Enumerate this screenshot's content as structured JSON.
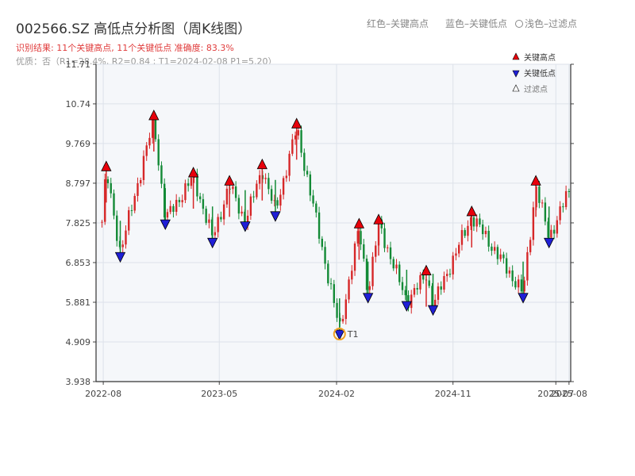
{
  "header": {
    "title": "002566.SZ 高低点分析图（周K线图）",
    "summary": "识别结果: 11个关键高点, 11个关键低点   准确度: 83.3%",
    "quality": "优质：否（R1=28.4%, R2=0.84 ; T1=2024-02-08 P1=5.20）"
  },
  "top_legend": {
    "high": "红色–关键高点",
    "low": "蓝色–关键低点",
    "filtered": "浅色–过滤点"
  },
  "colors": {
    "up": "#d62728",
    "down": "#138a36",
    "high_marker": "#e8000b",
    "low_marker": "#1f1fd6",
    "t1": "#f0a020",
    "plot_bg": "#f5f7fa",
    "grid": "#dde2ea"
  },
  "chart_data": {
    "type": "candlestick",
    "title": "002566.SZ 高低点分析图（周K线图）",
    "ylim": [
      3.938,
      11.71
    ],
    "yticks": [
      "3.938",
      "4.909",
      "5.881",
      "6.853",
      "7.825",
      "8.797",
      "9.769",
      "10.74",
      "11.71"
    ],
    "xlim": [
      "2022-07-15",
      "2025-08-05"
    ],
    "xticks": [
      {
        "label": "2022-08",
        "date": "2022-08-01"
      },
      {
        "label": "2023-05",
        "date": "2023-05-01"
      },
      {
        "label": "2024-02",
        "date": "2024-02-01"
      },
      {
        "label": "2024-11",
        "date": "2024-11-01"
      },
      {
        "label": "2025-07",
        "date": "2025-07-01"
      },
      {
        "label": "2025-08",
        "date": "2025-08-01"
      }
    ],
    "key_highs": [
      {
        "date": "2022-08-08",
        "value": 9.1
      },
      {
        "date": "2022-11-28",
        "value": 10.35
      },
      {
        "date": "2023-03-01",
        "value": 8.95
      },
      {
        "date": "2023-05-25",
        "value": 8.75
      },
      {
        "date": "2023-08-10",
        "value": 9.15
      },
      {
        "date": "2023-10-30",
        "value": 10.15
      },
      {
        "date": "2024-03-25",
        "value": 7.7
      },
      {
        "date": "2024-05-10",
        "value": 7.8
      },
      {
        "date": "2024-08-30",
        "value": 6.55
      },
      {
        "date": "2024-12-15",
        "value": 8.0
      },
      {
        "date": "2025-05-15",
        "value": 8.75
      }
    ],
    "key_lows": [
      {
        "date": "2022-09-10",
        "value": 7.1
      },
      {
        "date": "2022-12-25",
        "value": 7.9
      },
      {
        "date": "2023-04-15",
        "value": 7.45
      },
      {
        "date": "2023-07-01",
        "value": 7.85
      },
      {
        "date": "2023-09-10",
        "value": 8.1
      },
      {
        "date": "2024-02-08",
        "value": 5.2
      },
      {
        "date": "2024-04-15",
        "value": 6.1
      },
      {
        "date": "2024-07-15",
        "value": 5.9
      },
      {
        "date": "2024-09-15",
        "value": 5.8
      },
      {
        "date": "2025-04-15",
        "value": 6.1
      },
      {
        "date": "2025-06-15",
        "value": 7.45
      }
    ],
    "t1": {
      "label": "T1",
      "date": "2024-02-08",
      "value": 5.2
    },
    "legend": {
      "position": "top-right",
      "entries": [
        "关键高点",
        "关键低点",
        "过滤点"
      ]
    },
    "grid": true
  }
}
